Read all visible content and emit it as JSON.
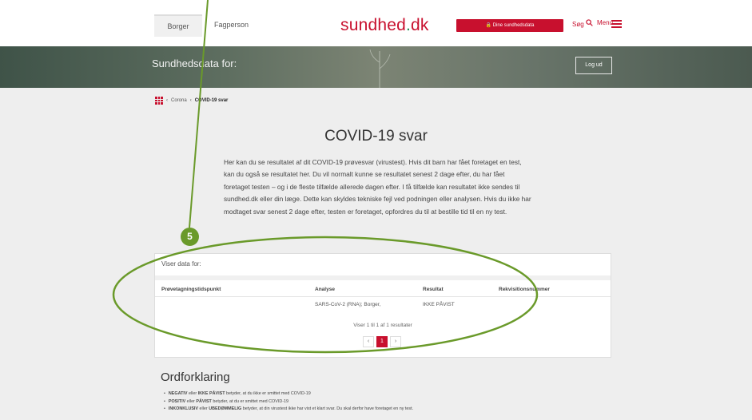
{
  "header": {
    "tab_borger": "Borger",
    "tab_fagperson": "Fagperson",
    "logo_main": "sundhed",
    "logo_dot": ".",
    "logo_tld": "dk",
    "data_button": "Dine sundhedsdata",
    "search_label": "Søg",
    "menu_label": "Menu"
  },
  "hero": {
    "title": "Sundhedsdata for:",
    "logout": "Log ud"
  },
  "breadcrumb": {
    "parent": "Corona",
    "current": "COVID-19 svar"
  },
  "page": {
    "title": "COVID-19 svar",
    "intro": "Her kan du se resultatet af dit COVID-19 prøvesvar (virustest). Hvis dit barn har fået foretaget en test, kan du også se resultatet her. Du vil normalt kunne se resultatet senest 2 dage efter, du har fået foretaget testen – og i de fleste tilfælde allerede dagen efter. I få tilfælde kan resultatet ikke sendes til sundhed.dk eller din læge. Dette kan skyldes tekniske fejl ved podningen eller analysen. Hvis du ikke har modtaget svar senest 2 dage efter, testen er foretaget, opfordres du til at bestille tid til en ny test."
  },
  "table": {
    "showing_for": "Viser data for:",
    "columns": [
      "Prøvetagningstidspunkt",
      "Analyse",
      "Resultat",
      "Rekvisitionsnummer"
    ],
    "rows": [
      [
        "",
        "SARS-CoV-2 (RNA); Borger,",
        "IKKE PÅVIST",
        ""
      ]
    ],
    "info": "Viser 1 til 1 af 1 resultater",
    "pager": {
      "prev": "‹",
      "page": "1",
      "next": "›"
    }
  },
  "definitions": {
    "title": "Ordforklaring",
    "items": [
      {
        "bold": "NEGATIV",
        "mid": " eller ",
        "bold2": "IKKE PÅVIST",
        "rest": " betyder, at du ikke er smittet med COVID-19"
      },
      {
        "bold": "POSITIV",
        "mid": " eller ",
        "bold2": "PÅVIST",
        "rest": " betyder, at du er smittet med COVID-19"
      },
      {
        "bold": "INKONKLUSIV",
        "mid": " eller ",
        "bold2": "UBEDØMMELIG",
        "rest": " betyder, at din virustest ikke har vist et klart svar. Du skal derfor have foretaget en ny test."
      }
    ]
  },
  "annotation": {
    "badge": "5",
    "color": "#6a9a2a"
  }
}
